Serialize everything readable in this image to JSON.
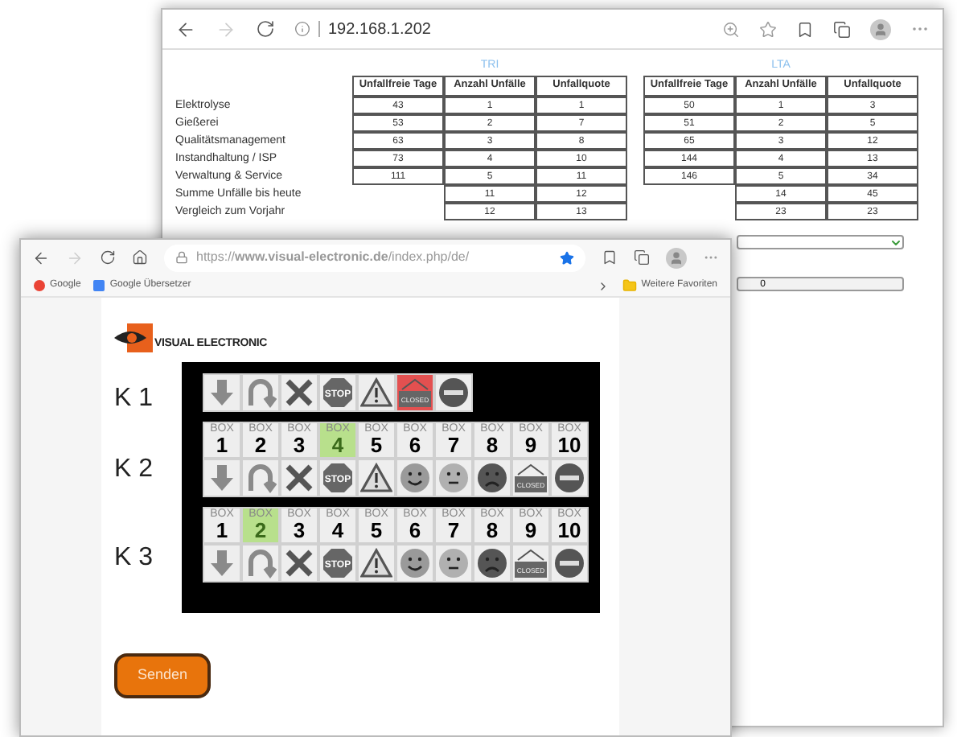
{
  "back_window": {
    "address": "192.168.1.202",
    "row_labels": [
      "Elektrolyse",
      "Gießerei",
      "Qualitätsmanagement",
      "Instandhaltung / ISP",
      "Verwaltung & Service",
      "Summe Unfälle bis heute",
      "Vergleich zum Vorjahr"
    ],
    "tables": [
      {
        "title": "TRI",
        "columns": [
          "Unfallfreie Tage",
          "Anzahl Unfälle",
          "Unfallquote"
        ],
        "rows": [
          [
            "43",
            "1",
            "1"
          ],
          [
            "53",
            "2",
            "7"
          ],
          [
            "63",
            "3",
            "8"
          ],
          [
            "73",
            "4",
            "10"
          ],
          [
            "111",
            "5",
            "11"
          ]
        ],
        "totals": [
          [
            "11",
            "12"
          ],
          [
            "12",
            "13"
          ]
        ]
      },
      {
        "title": "LTA",
        "columns": [
          "Unfallfreie Tage",
          "Anzahl Unfälle",
          "Unfallquote"
        ],
        "rows": [
          [
            "50",
            "1",
            "3"
          ],
          [
            "51",
            "2",
            "5"
          ],
          [
            "65",
            "3",
            "12"
          ],
          [
            "144",
            "4",
            "13"
          ],
          [
            "146",
            "5",
            "34"
          ]
        ],
        "totals": [
          [
            "14",
            "45"
          ],
          [
            "23",
            "23"
          ]
        ]
      }
    ],
    "counter_field": {
      "value": "0"
    }
  },
  "front_window": {
    "address": "https://**www.visual-electronic.de**/index.php/de/",
    "bookmarks": [
      "Google",
      "Google Übersetzer"
    ],
    "other_favorites": "Weitere Favoriten",
    "logo_text": "VISUAL ELECTRONIC",
    "rows": [
      {
        "label": "K 1",
        "icons": [
          {
            "kind": "down",
            "selected": false
          },
          {
            "kind": "uturn",
            "selected": false
          },
          {
            "kind": "cross",
            "selected": false
          },
          {
            "kind": "stop",
            "label": "STOP",
            "selected": false
          },
          {
            "kind": "warning",
            "selected": false
          },
          {
            "kind": "closed",
            "label": "CLOSED",
            "selected": true
          },
          {
            "kind": "noentry",
            "selected": false
          }
        ]
      },
      {
        "label": "K 2",
        "boxes": [
          {
            "caption": "BOX",
            "number": "1",
            "selected": false
          },
          {
            "caption": "BOX",
            "number": "2",
            "selected": false
          },
          {
            "caption": "BOX",
            "number": "3",
            "selected": false
          },
          {
            "caption": "BOX",
            "number": "4",
            "selected": true
          },
          {
            "caption": "BOX",
            "number": "5",
            "selected": false
          },
          {
            "caption": "BOX",
            "number": "6",
            "selected": false
          },
          {
            "caption": "BOX",
            "number": "7",
            "selected": false
          },
          {
            "caption": "BOX",
            "number": "8",
            "selected": false
          },
          {
            "caption": "BOX",
            "number": "9",
            "selected": false
          },
          {
            "caption": "BOX",
            "number": "10",
            "selected": false
          }
        ],
        "icons": [
          {
            "kind": "down",
            "selected": false
          },
          {
            "kind": "uturn",
            "selected": false
          },
          {
            "kind": "cross",
            "selected": false
          },
          {
            "kind": "stop",
            "label": "STOP",
            "selected": false
          },
          {
            "kind": "warning",
            "selected": false
          },
          {
            "kind": "happy",
            "selected": false
          },
          {
            "kind": "neutral",
            "selected": false
          },
          {
            "kind": "sad",
            "selected": false
          },
          {
            "kind": "closed",
            "label": "CLOSED",
            "selected": false
          },
          {
            "kind": "noentry",
            "selected": false
          }
        ]
      },
      {
        "label": "K 3",
        "boxes": [
          {
            "caption": "BOX",
            "number": "1",
            "selected": false
          },
          {
            "caption": "BOX",
            "number": "2",
            "selected": true
          },
          {
            "caption": "BOX",
            "number": "3",
            "selected": false
          },
          {
            "caption": "BOX",
            "number": "4",
            "selected": false
          },
          {
            "caption": "BOX",
            "number": "5",
            "selected": false
          },
          {
            "caption": "BOX",
            "number": "6",
            "selected": false
          },
          {
            "caption": "BOX",
            "number": "7",
            "selected": false
          },
          {
            "caption": "BOX",
            "number": "8",
            "selected": false
          },
          {
            "caption": "BOX",
            "number": "9",
            "selected": false
          },
          {
            "caption": "BOX",
            "number": "10",
            "selected": false
          }
        ],
        "icons": [
          {
            "kind": "down",
            "selected": false
          },
          {
            "kind": "uturn",
            "selected": false
          },
          {
            "kind": "cross",
            "selected": false
          },
          {
            "kind": "stop",
            "label": "STOP",
            "selected": false
          },
          {
            "kind": "warning",
            "selected": false
          },
          {
            "kind": "happy",
            "selected": false
          },
          {
            "kind": "neutral",
            "selected": false
          },
          {
            "kind": "sad",
            "selected": false
          },
          {
            "kind": "closed",
            "label": "CLOSED",
            "selected": false
          },
          {
            "kind": "noentry",
            "selected": false
          }
        ]
      }
    ],
    "send_button": "Senden"
  }
}
